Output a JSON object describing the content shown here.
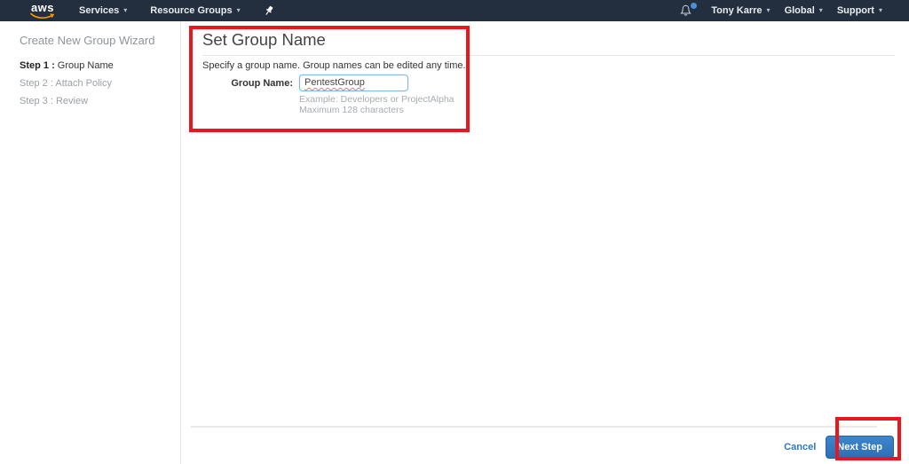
{
  "navbar": {
    "logo_text": "aws",
    "services_label": "Services",
    "resource_groups_label": "Resource Groups",
    "user_label": "Tony Karre",
    "region_label": "Global",
    "support_label": "Support",
    "caret": "▾",
    "colors": {
      "background": "#232f3e",
      "logo_accent": "#ff9900",
      "notification_dot": "#4a90d9"
    }
  },
  "sidebar": {
    "title": "Create New Group Wizard",
    "steps": [
      {
        "prefix": "Step 1 :",
        "label": " Group Name",
        "state": "active"
      },
      {
        "prefix": "Step 2 :",
        "label": " Attach Policy",
        "state": "inactive"
      },
      {
        "prefix": "Step 3 :",
        "label": " Review",
        "state": "inactive"
      }
    ]
  },
  "main": {
    "title": "Set Group Name",
    "description": "Specify a group name. Group names can be edited any time.",
    "form": {
      "label": "Group Name:",
      "value": "PentestGroup",
      "hint_line1": "Example: Developers or ProjectAlpha",
      "hint_line2": "Maximum 128 characters"
    },
    "footer": {
      "cancel_label": "Cancel",
      "next_label": "Next Step"
    }
  },
  "annotations": {
    "color": "#e8161d",
    "boxes": [
      {
        "name": "group-name-section-highlight"
      },
      {
        "name": "next-step-button-highlight"
      }
    ]
  }
}
